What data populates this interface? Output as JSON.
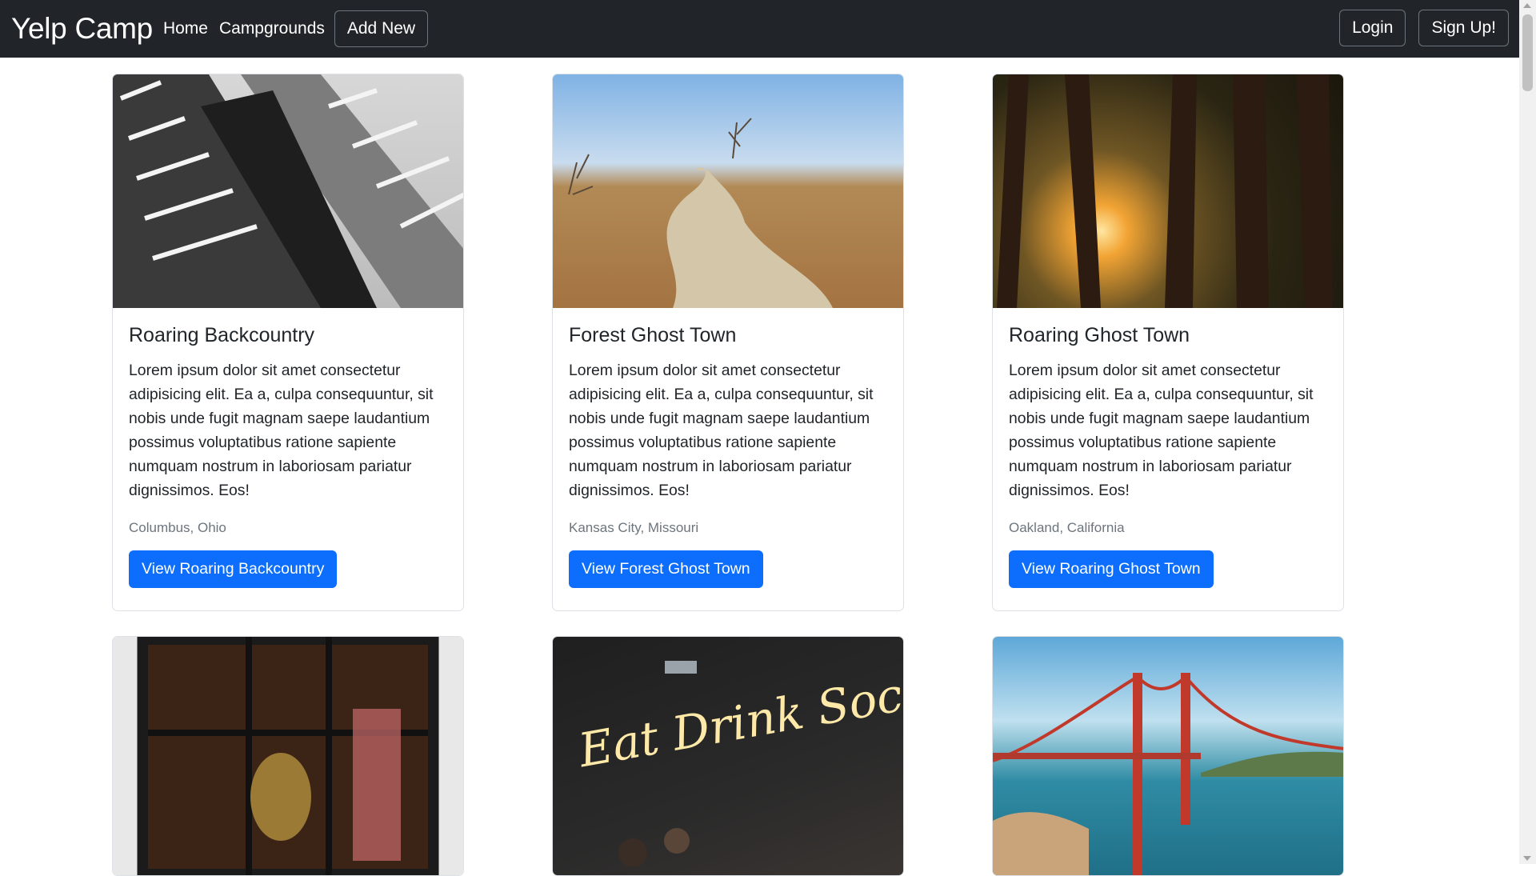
{
  "navbar": {
    "brand": "Yelp Camp",
    "links": [
      "Home",
      "Campgrounds"
    ],
    "add_new": "Add New",
    "login": "Login",
    "signup": "Sign Up!"
  },
  "campgrounds": [
    {
      "title": "Roaring Backcountry",
      "description": "Lorem ipsum dolor sit amet consectetur adipisicing elit. Ea a, culpa consequuntur, sit nobis unde fugit magnam saepe laudantium possimus voluptatibus ratione sapiente numquam nostrum in laboriosam pariatur dignissimos. Eos!",
      "location": "Columbus, Ohio",
      "button": "View Roaring Backcountry"
    },
    {
      "title": "Forest Ghost Town",
      "description": "Lorem ipsum dolor sit amet consectetur adipisicing elit. Ea a, culpa consequuntur, sit nobis unde fugit magnam saepe laudantium possimus voluptatibus ratione sapiente numquam nostrum in laboriosam pariatur dignissimos. Eos!",
      "location": "Kansas City, Missouri",
      "button": "View Forest Ghost Town"
    },
    {
      "title": "Roaring Ghost Town",
      "description": "Lorem ipsum dolor sit amet consectetur adipisicing elit. Ea a, culpa consequuntur, sit nobis unde fugit magnam saepe laudantium possimus voluptatibus ratione sapiente numquam nostrum in laboriosam pariatur dignissimos. Eos!",
      "location": "Oakland, California",
      "button": "View Roaring Ghost Town"
    }
  ],
  "neon_sign_text": "Eat Drink Social"
}
